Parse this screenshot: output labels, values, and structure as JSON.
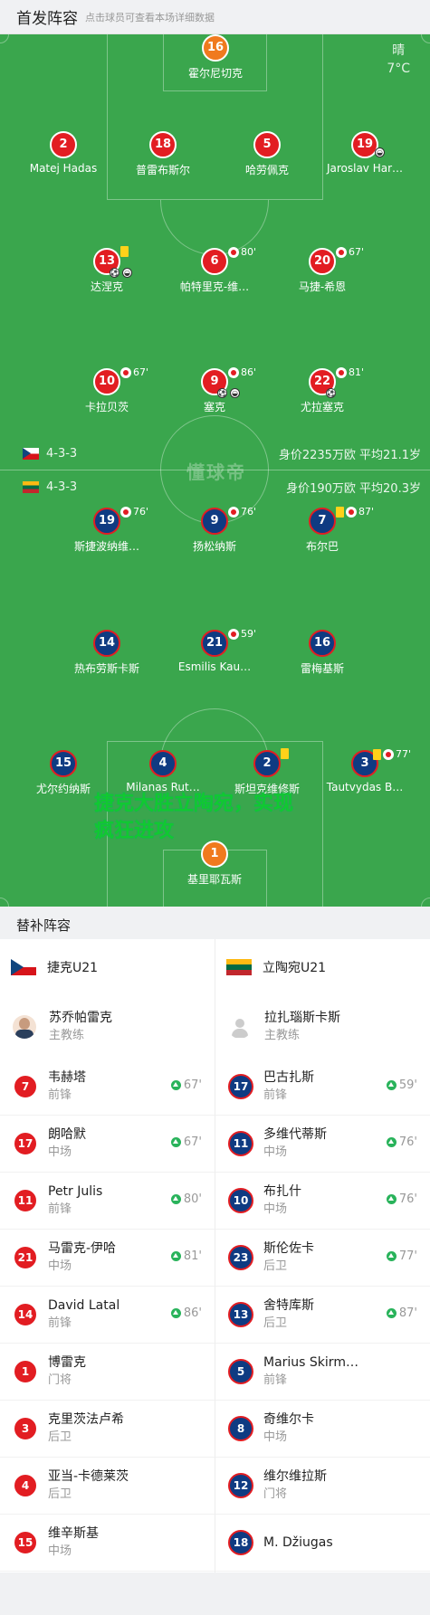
{
  "header": {
    "title": "首发阵容",
    "hint": "点击球员可查看本场详细数据"
  },
  "weather": {
    "cond": "晴",
    "temp": "7°C"
  },
  "watermark": "懂球帝",
  "teams": {
    "home": {
      "formation": "4-3-3",
      "stats": "身价2235万欧  平均21.1岁"
    },
    "away": {
      "formation": "4-3-3",
      "stats": "身价190万欧   平均20.3岁"
    }
  },
  "overlay": {
    "line1": "捷克大胜立陶宛，实现",
    "line2": "疯狂进攻"
  },
  "players": [
    {
      "num": "16",
      "name": "霍尔尼切克",
      "kind": "gk"
    },
    {
      "num": "2",
      "name": "Matej Hadas",
      "kind": "cz"
    },
    {
      "num": "18",
      "name": "普雷布斯尔",
      "kind": "cz"
    },
    {
      "num": "5",
      "name": "哈劳佩克",
      "kind": "cz"
    },
    {
      "num": "19",
      "name": "Jaroslav Har…",
      "kind": "cz"
    },
    {
      "num": "13",
      "name": "达涅克",
      "kind": "cz"
    },
    {
      "num": "6",
      "name": "帕特里克-维…",
      "kind": "cz",
      "min": "80'"
    },
    {
      "num": "20",
      "name": "马捷-希恩",
      "kind": "cz",
      "min": "67'"
    },
    {
      "num": "10",
      "name": "卡拉贝茨",
      "kind": "cz",
      "min": "67'"
    },
    {
      "num": "9",
      "name": "塞克",
      "kind": "cz",
      "min": "86'"
    },
    {
      "num": "22",
      "name": "尤拉塞克",
      "kind": "cz",
      "min": "81'"
    },
    {
      "num": "19",
      "name": "斯捷波纳维…",
      "kind": "lt",
      "min": "76'"
    },
    {
      "num": "9",
      "name": "扬松纳斯",
      "kind": "lt",
      "min": "76'"
    },
    {
      "num": "7",
      "name": "布尔巴",
      "kind": "lt",
      "min": "87'"
    },
    {
      "num": "14",
      "name": "热布劳斯卡斯",
      "kind": "lt"
    },
    {
      "num": "21",
      "name": "Esmilis Kau…",
      "kind": "lt",
      "min": "59'"
    },
    {
      "num": "16",
      "name": "雷梅基斯",
      "kind": "lt"
    },
    {
      "num": "15",
      "name": "尤尔约纳斯",
      "kind": "lt"
    },
    {
      "num": "4",
      "name": "Milanas Rut…",
      "kind": "lt"
    },
    {
      "num": "2",
      "name": "斯坦克维修斯",
      "kind": "lt"
    },
    {
      "num": "3",
      "name": "Tautvydas B…",
      "kind": "lt",
      "min": "77'"
    },
    {
      "num": "1",
      "name": "基里耶瓦斯",
      "kind": "gk"
    }
  ],
  "subs_title": "替补阵容",
  "bench": {
    "home": {
      "team": "捷克U21",
      "coach": "苏乔帕雷克",
      "coach_role": "主教练",
      "players": [
        {
          "num": "7",
          "name": "韦赫塔",
          "pos": "前锋",
          "min": "67'"
        },
        {
          "num": "17",
          "name": "朗哈默",
          "pos": "中场",
          "min": "67'"
        },
        {
          "num": "11",
          "name": "Petr Julis",
          "pos": "前锋",
          "min": "80'"
        },
        {
          "num": "21",
          "name": "马雷克-伊哈",
          "pos": "中场",
          "min": "81'"
        },
        {
          "num": "14",
          "name": "David Latal",
          "pos": "前锋",
          "min": "86'"
        },
        {
          "num": "1",
          "name": "博雷克",
          "pos": "门将"
        },
        {
          "num": "3",
          "name": "克里茨法卢希",
          "pos": "后卫"
        },
        {
          "num": "4",
          "name": "亚当-卡德莱茨",
          "pos": "后卫"
        },
        {
          "num": "15",
          "name": "维辛斯基",
          "pos": "中场"
        }
      ]
    },
    "away": {
      "team": "立陶宛U21",
      "coach": "拉扎瑙斯卡斯",
      "coach_role": "主教练",
      "players": [
        {
          "num": "17",
          "name": "巴古扎斯",
          "pos": "前锋",
          "min": "59'"
        },
        {
          "num": "11",
          "name": "多维代蒂斯",
          "pos": "中场",
          "min": "76'"
        },
        {
          "num": "10",
          "name": "布扎什",
          "pos": "中场",
          "min": "76'"
        },
        {
          "num": "23",
          "name": "斯伦佐卡",
          "pos": "后卫",
          "min": "77'"
        },
        {
          "num": "13",
          "name": "舍特库斯",
          "pos": "后卫",
          "min": "87'"
        },
        {
          "num": "5",
          "name": "Marius Skirm…",
          "pos": "前锋"
        },
        {
          "num": "8",
          "name": "奇维尔卡",
          "pos": "中场"
        },
        {
          "num": "12",
          "name": "维尔维拉斯",
          "pos": "门将"
        },
        {
          "num": "18",
          "name": "M. Džiugas",
          "pos": ""
        }
      ]
    }
  }
}
